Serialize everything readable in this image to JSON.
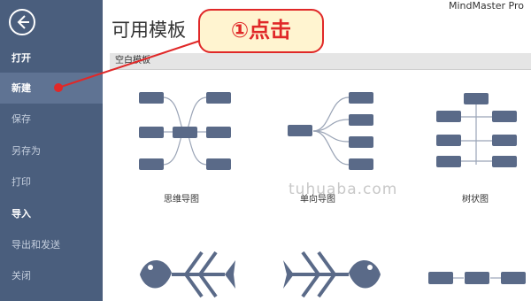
{
  "app": {
    "title": "MindMaster Pro"
  },
  "sidebar": {
    "items": [
      {
        "label": "打开"
      },
      {
        "label": "新建"
      },
      {
        "label": "保存"
      },
      {
        "label": "另存为"
      },
      {
        "label": "打印"
      },
      {
        "label": "导入"
      },
      {
        "label": "导出和发送"
      },
      {
        "label": "关闭"
      }
    ]
  },
  "main": {
    "title": "可用模板",
    "section": "空白模板",
    "templates": [
      {
        "label": "思维导图"
      },
      {
        "label": "单向导图"
      },
      {
        "label": "树状图"
      }
    ]
  },
  "callout": {
    "text": "①点击"
  },
  "watermark": "tuhuaba.com",
  "colors": {
    "sidebar": "#4a5e7d",
    "node": "#5a6a88",
    "callout_border": "#e02828",
    "callout_fill": "#fff4d0"
  }
}
